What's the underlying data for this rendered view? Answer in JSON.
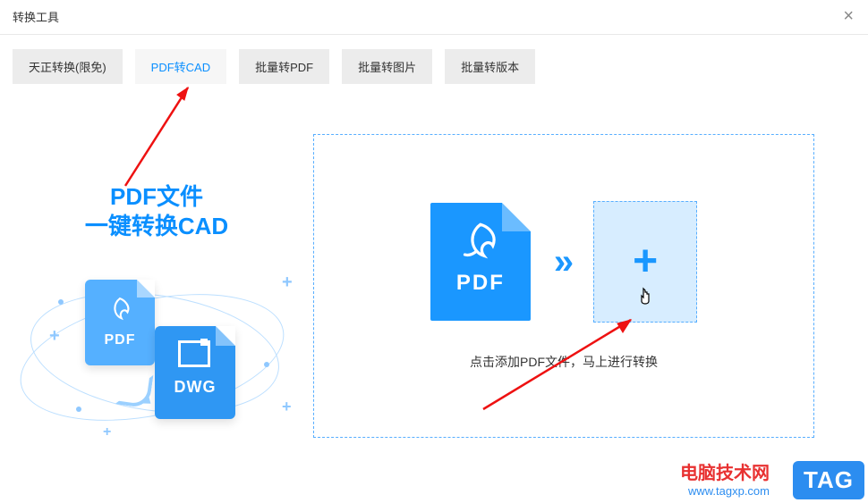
{
  "window": {
    "title": "转换工具"
  },
  "tabs": {
    "items": [
      {
        "label": "天正转换(限免)"
      },
      {
        "label": "PDF转CAD"
      },
      {
        "label": "批量转PDF"
      },
      {
        "label": "批量转图片"
      },
      {
        "label": "批量转版本"
      }
    ],
    "active_index": 1
  },
  "promo": {
    "line1": "PDF文件",
    "line2": "一键转换CAD",
    "pdf_label": "PDF",
    "dwg_label": "DWG"
  },
  "dropzone": {
    "pdf_label": "PDF",
    "caption": "点击添加PDF文件，马上进行转换"
  },
  "watermark": {
    "title": "电脑技术网",
    "url": "www.tagxp.com",
    "badge": "TAG"
  },
  "colors": {
    "accent": "#1a97ff",
    "accent_light": "#d7edff",
    "arrow_red": "#e11"
  },
  "annotations": {
    "arrow1": "points to PDF转CAD tab",
    "arrow2": "points to add-file drop box"
  }
}
